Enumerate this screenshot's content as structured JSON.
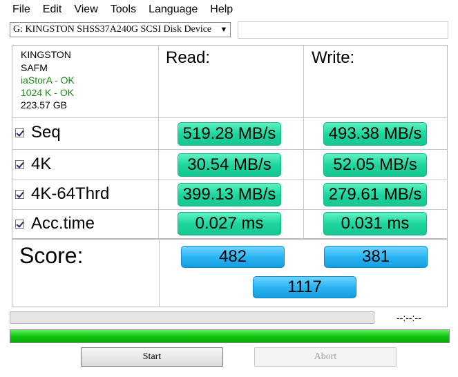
{
  "menu": [
    "File",
    "Edit",
    "View",
    "Tools",
    "Language",
    "Help"
  ],
  "drive": {
    "selected": "G: KINGSTON SHSS37A240G SCSI Disk Device",
    "arrow": "▼"
  },
  "info": {
    "model": "KINGSTON",
    "firmware": "SAFM",
    "driver": "iaStorA - OK",
    "alignment": "1024 K - OK",
    "size": "223.57 GB"
  },
  "columns": {
    "read": "Read:",
    "write": "Write:"
  },
  "rows": [
    {
      "label": "Seq",
      "read": "519.28 MB/s",
      "write": "493.38 MB/s"
    },
    {
      "label": "4K",
      "read": "30.54 MB/s",
      "write": "52.05 MB/s"
    },
    {
      "label": "4K-64Thrd",
      "read": "399.13 MB/s",
      "write": "279.61 MB/s"
    },
    {
      "label": "Acc.time",
      "read": "0.027 ms",
      "write": "0.031 ms"
    }
  ],
  "score": {
    "label": "Score:",
    "read": "482",
    "write": "381",
    "total": "1117"
  },
  "progress": {
    "time": "--:--:--",
    "overall_fraction": 1.0
  },
  "buttons": {
    "start": "Start",
    "abort": "Abort"
  },
  "colors": {
    "value_bg": "#1ed69e",
    "score_bg": "#2bb4f2",
    "progress_fill": "#12c512"
  }
}
